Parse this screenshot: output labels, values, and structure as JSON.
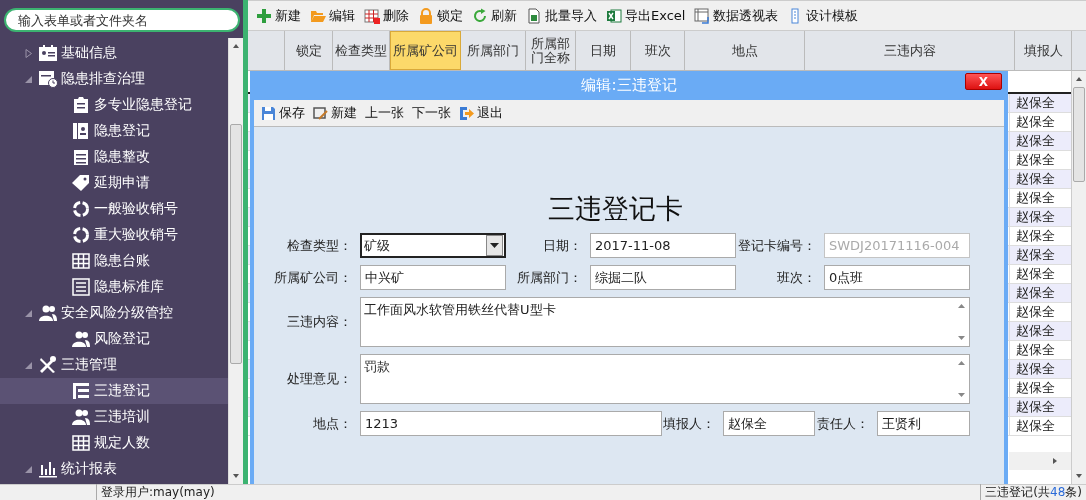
{
  "sidebar": {
    "search": {
      "placeholder": "输入表单或者文件夹名"
    },
    "tree": [
      {
        "label": "基础信息",
        "expanded": false,
        "selected": false
      },
      {
        "label": "隐患排查治理",
        "expanded": true,
        "selected": false,
        "children": [
          {
            "label": "多专业隐患登记",
            "selected": false
          },
          {
            "label": "隐患登记",
            "selected": false
          },
          {
            "label": "隐患整改",
            "selected": false
          },
          {
            "label": "延期申请",
            "selected": false
          },
          {
            "label": "一般验收销号",
            "selected": false
          },
          {
            "label": "重大验收销号",
            "selected": false
          },
          {
            "label": "隐患台账",
            "selected": false
          },
          {
            "label": "隐患标准库",
            "selected": false
          }
        ]
      },
      {
        "label": "安全风险分级管控",
        "expanded": true,
        "selected": false,
        "children": [
          {
            "label": "风险登记",
            "selected": false
          }
        ]
      },
      {
        "label": "三违管理",
        "expanded": true,
        "selected": false,
        "children": [
          {
            "label": "三违登记",
            "selected": true
          },
          {
            "label": "三违培训",
            "selected": false
          },
          {
            "label": "规定人数",
            "selected": false
          }
        ]
      },
      {
        "label": "统计报表",
        "expanded": true,
        "selected": false
      }
    ]
  },
  "toolbar": [
    "新建",
    "编辑",
    "删除",
    "锁定",
    "刷新",
    "批量导入",
    "导出Excel",
    "数据透视表",
    "设计模板"
  ],
  "grid": {
    "columns": [
      {
        "label": "锁定",
        "selected": false
      },
      {
        "label": "检查类型",
        "selected": false
      },
      {
        "label": "所属矿公司",
        "selected": true
      },
      {
        "label": "所属部门",
        "selected": false
      },
      {
        "label": "所属部门全称",
        "selected": false
      },
      {
        "label": "日期",
        "selected": false
      },
      {
        "label": "班次",
        "selected": false
      },
      {
        "label": "地点",
        "selected": false
      },
      {
        "label": "三违内容",
        "selected": false
      },
      {
        "label": "填报人",
        "selected": false
      }
    ],
    "rows": [
      {
        "reporter": "赵保全"
      },
      {
        "reporter": "赵保全"
      },
      {
        "reporter": "赵保全"
      },
      {
        "reporter": "赵保全"
      },
      {
        "reporter": "赵保全"
      },
      {
        "reporter": "赵保全"
      },
      {
        "reporter": "赵保全"
      },
      {
        "reporter": "赵保全"
      },
      {
        "reporter": "赵保全"
      },
      {
        "reporter": "赵保全"
      },
      {
        "reporter": "赵保全"
      },
      {
        "reporter": "赵保全"
      },
      {
        "reporter": "赵保全"
      },
      {
        "reporter": "赵保全"
      },
      {
        "reporter": "赵保全"
      },
      {
        "reporter": "赵保全"
      },
      {
        "reporter": "赵保全"
      },
      {
        "reporter": "赵保全"
      }
    ]
  },
  "dialog": {
    "title": "编辑:三违登记",
    "close": "X",
    "toolbar": [
      "保存",
      "新建",
      "上一张",
      "下一张",
      "退出"
    ],
    "heading": "三违登记卡",
    "rows": [
      [
        {
          "label": "检查类型：",
          "value": "矿级",
          "kind": "select",
          "disabled": false
        },
        {
          "label": "日期：",
          "value": "2017-11-08",
          "kind": "text",
          "disabled": false
        },
        {
          "label": "登记卡编号：",
          "value": "SWDJ20171116-004",
          "kind": "text",
          "disabled": true
        }
      ],
      [
        {
          "label": "所属矿公司：",
          "value": "中兴矿",
          "kind": "text",
          "disabled": false
        },
        {
          "label": "所属部门：",
          "value": "综掘二队",
          "kind": "text",
          "disabled": false
        },
        {
          "label": "班次：",
          "value": "0点班",
          "kind": "text",
          "disabled": false
        }
      ],
      [
        {
          "label": "三违内容：",
          "value": "工作面风水软管用铁丝代替U型卡",
          "kind": "textarea",
          "disabled": false
        }
      ],
      [
        {
          "label": "处理意见：",
          "value": "罚款",
          "kind": "textarea",
          "disabled": false
        }
      ],
      [
        {
          "label": "地点：",
          "value": "1213",
          "kind": "text",
          "disabled": false
        },
        {
          "label": "填报人：",
          "value": "赵保全",
          "kind": "text",
          "disabled": false
        },
        {
          "label": "责任人：",
          "value": "王贤利",
          "kind": "text",
          "disabled": false
        }
      ]
    ]
  },
  "status_bar": {
    "user": "登录用户:may(may)",
    "record_prefix": "三违登记(共",
    "record_count": "48",
    "record_suffix": "条)"
  }
}
